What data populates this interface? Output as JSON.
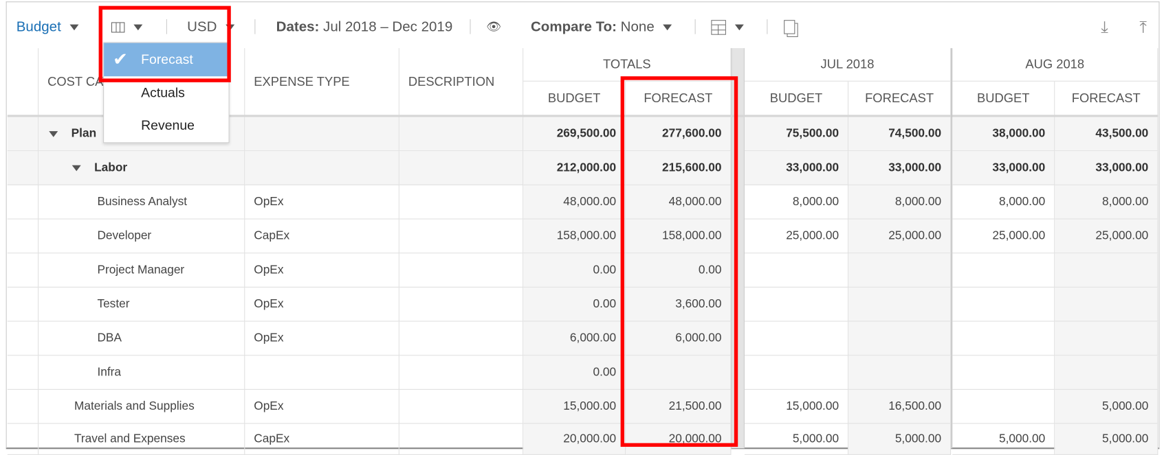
{
  "toolbar": {
    "budget_label": "Budget",
    "currency": "USD",
    "dates_label": "Dates:",
    "dates_value": "Jul 2018 – Dec 2019",
    "compare_label": "Compare To:",
    "compare_value": "None",
    "accent_color": "#1a6fb5"
  },
  "column_menu": {
    "items": [
      {
        "label": "Forecast",
        "checked": true
      },
      {
        "label": "Actuals",
        "checked": false
      },
      {
        "label": "Revenue",
        "checked": false
      }
    ],
    "highlight_color": "#7fb3e3"
  },
  "headers": {
    "cost_category": "COST CATEGORY",
    "expense_type": "EXPENSE TYPE",
    "description": "DESCRIPTION",
    "groups": [
      "TOTALS",
      "JUL 2018",
      "AUG 2018"
    ],
    "sub": [
      "BUDGET",
      "FORECAST"
    ]
  },
  "rows": [
    {
      "name": "Plan",
      "level": 0,
      "expander": true,
      "bold": true,
      "type": "",
      "values": [
        "269,500.00",
        "277,600.00",
        "75,500.00",
        "74,500.00",
        "38,000.00",
        "43,500.00"
      ]
    },
    {
      "name": "Labor",
      "level": 1,
      "expander": true,
      "bold": true,
      "type": "",
      "values": [
        "212,000.00",
        "215,600.00",
        "33,000.00",
        "33,000.00",
        "33,000.00",
        "33,000.00"
      ]
    },
    {
      "name": "Business Analyst",
      "level": 2,
      "type": "OpEx",
      "values": [
        "48,000.00",
        "48,000.00",
        "8,000.00",
        "8,000.00",
        "8,000.00",
        "8,000.00"
      ]
    },
    {
      "name": "Developer",
      "level": 2,
      "type": "CapEx",
      "values": [
        "158,000.00",
        "158,000.00",
        "25,000.00",
        "25,000.00",
        "25,000.00",
        "25,000.00"
      ]
    },
    {
      "name": "Project Manager",
      "level": 2,
      "type": "OpEx",
      "values": [
        "0.00",
        "0.00",
        "",
        "",
        "",
        ""
      ]
    },
    {
      "name": "Tester",
      "level": 2,
      "type": "OpEx",
      "values": [
        "0.00",
        "3,600.00",
        "",
        "",
        "",
        ""
      ]
    },
    {
      "name": "DBA",
      "level": 2,
      "type": "OpEx",
      "values": [
        "6,000.00",
        "6,000.00",
        "",
        "",
        "",
        ""
      ]
    },
    {
      "name": "Infra",
      "level": 2,
      "type": "",
      "values": [
        "0.00",
        "",
        "",
        "",
        "",
        ""
      ]
    },
    {
      "name": "Materials and Supplies",
      "level": 1,
      "type": "OpEx",
      "values": [
        "15,000.00",
        "21,500.00",
        "15,000.00",
        "16,500.00",
        "",
        "5,000.00"
      ]
    },
    {
      "name": "Travel and Expenses",
      "level": 1,
      "type": "CapEx",
      "values": [
        "20,000.00",
        "20,000.00",
        "5,000.00",
        "5,000.00",
        "5,000.00",
        "5,000.00"
      ]
    }
  ]
}
